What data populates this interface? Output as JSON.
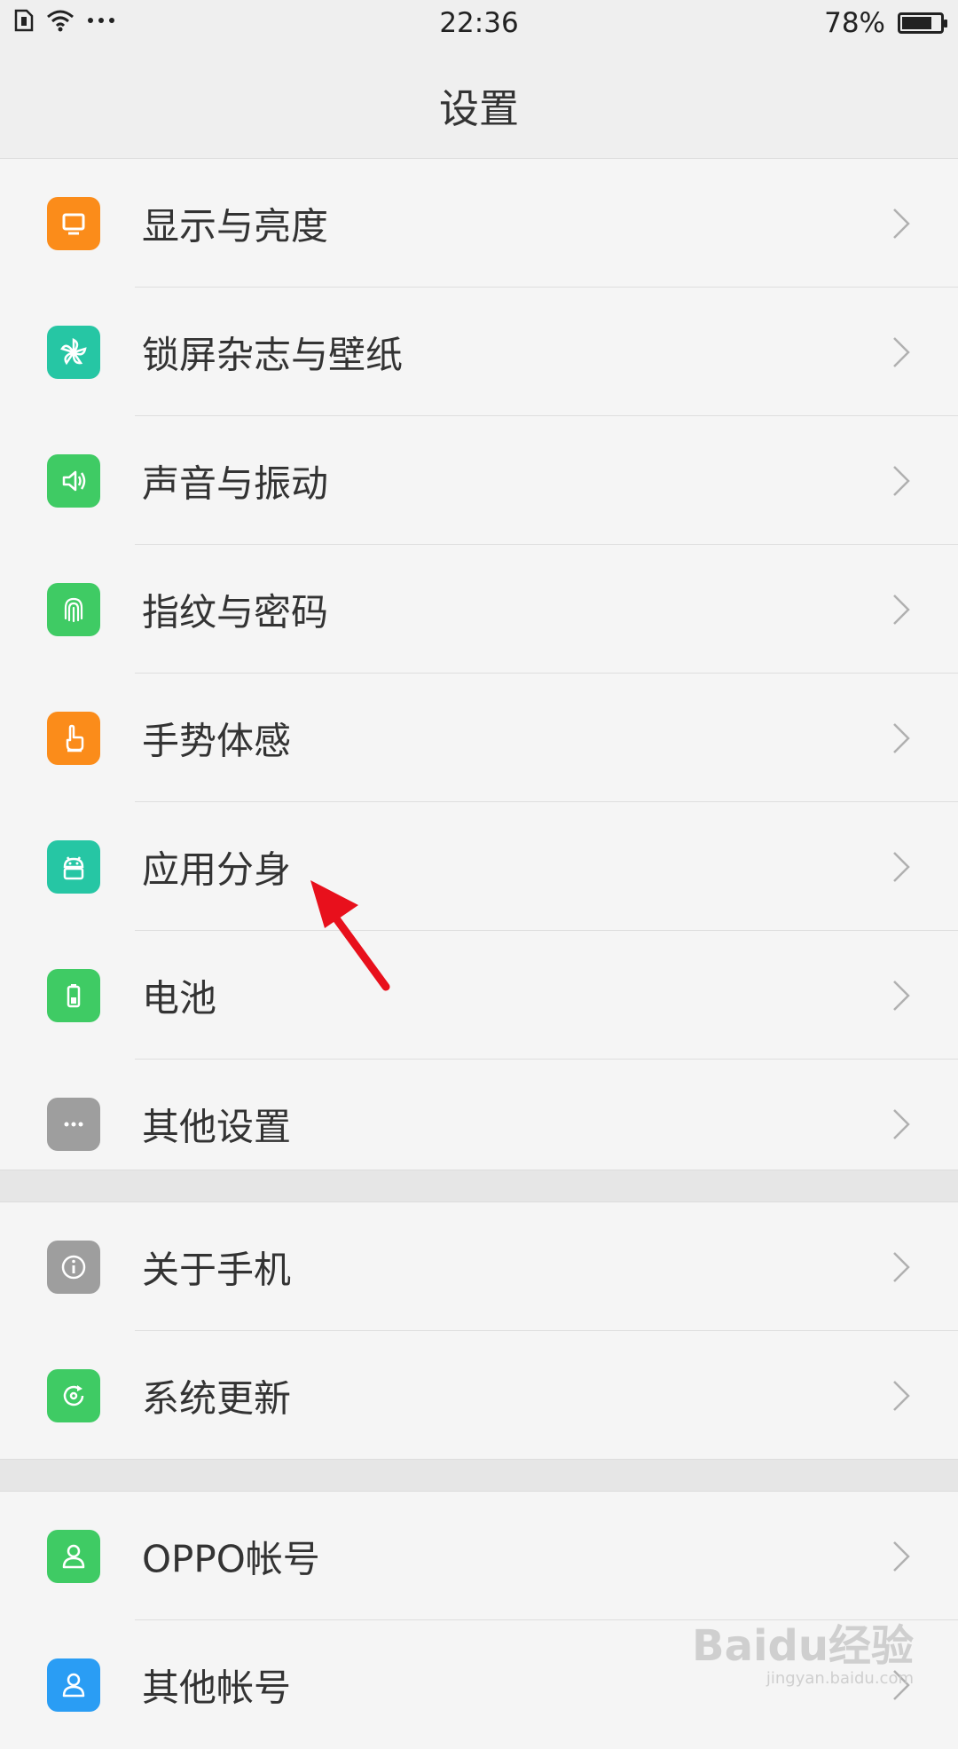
{
  "statusbar": {
    "time": "22:36",
    "battery_text": "78%",
    "battery_level": 0.78
  },
  "header": {
    "title": "设置"
  },
  "colors": {
    "orange": "#fb8c1a",
    "teal": "#26c6a4",
    "green": "#3fcb64",
    "gray": "#9e9e9e",
    "blue": "#2a9df4",
    "arrow": "#e8101c"
  },
  "sections": [
    {
      "items": [
        {
          "label": "显示与亮度",
          "icon": "monitor-icon",
          "color": "#fb8c1a"
        },
        {
          "label": "锁屏杂志与壁纸",
          "icon": "pinwheel-icon",
          "color": "#26c6a4"
        },
        {
          "label": "声音与振动",
          "icon": "speaker-icon",
          "color": "#3fcb64"
        },
        {
          "label": "指纹与密码",
          "icon": "fingerprint-icon",
          "color": "#3fcb64"
        },
        {
          "label": "手势体感",
          "icon": "hand-icon",
          "color": "#fb8c1a"
        },
        {
          "label": "应用分身",
          "icon": "android-icon",
          "color": "#26c6a4"
        },
        {
          "label": "电池",
          "icon": "battery-icon",
          "color": "#3fcb64"
        },
        {
          "label": "其他设置",
          "icon": "more-icon",
          "color": "#9e9e9e"
        }
      ]
    },
    {
      "items": [
        {
          "label": "关于手机",
          "icon": "info-icon",
          "color": "#9e9e9e"
        },
        {
          "label": "系统更新",
          "icon": "update-icon",
          "color": "#3fcb64"
        }
      ]
    },
    {
      "items": [
        {
          "label": "OPPO帐号",
          "icon": "user-icon",
          "color": "#3fcb64"
        },
        {
          "label": "其他帐号",
          "icon": "user-icon",
          "color": "#2a9df4"
        }
      ]
    }
  ],
  "watermark": {
    "text": "Baidu经验",
    "sub": "jingyan.baidu.com"
  }
}
